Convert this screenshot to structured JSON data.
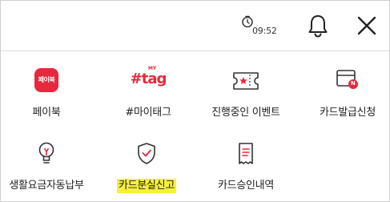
{
  "header": {
    "timer_text": "09:52",
    "timer_icon": "session-timer-icon",
    "bell_icon": "bell-icon",
    "close_icon": "close-icon"
  },
  "menu": [
    {
      "label": "페이북",
      "icon": "paybook-app-icon",
      "icon_text": "페이북"
    },
    {
      "label": "#마이태그",
      "icon": "mytag-logo-icon",
      "icon_text_top": "MY",
      "icon_text": "#tag"
    },
    {
      "label": "진행중인 이벤트",
      "icon": "ticket-icon"
    },
    {
      "label": "카드발급신청",
      "icon": "card-new-icon",
      "icon_text": "N"
    },
    {
      "label": "생활요금자동납부",
      "icon": "lightbulb-icon"
    },
    {
      "label": "카드분실신고",
      "icon": "shield-check-icon",
      "highlighted": true
    },
    {
      "label": "카드승인내역",
      "icon": "receipt-icon"
    }
  ],
  "colors": {
    "accent": "#e8283c",
    "highlight": "#f7f03a",
    "text": "#222222",
    "divider": "#dcdcdc"
  }
}
